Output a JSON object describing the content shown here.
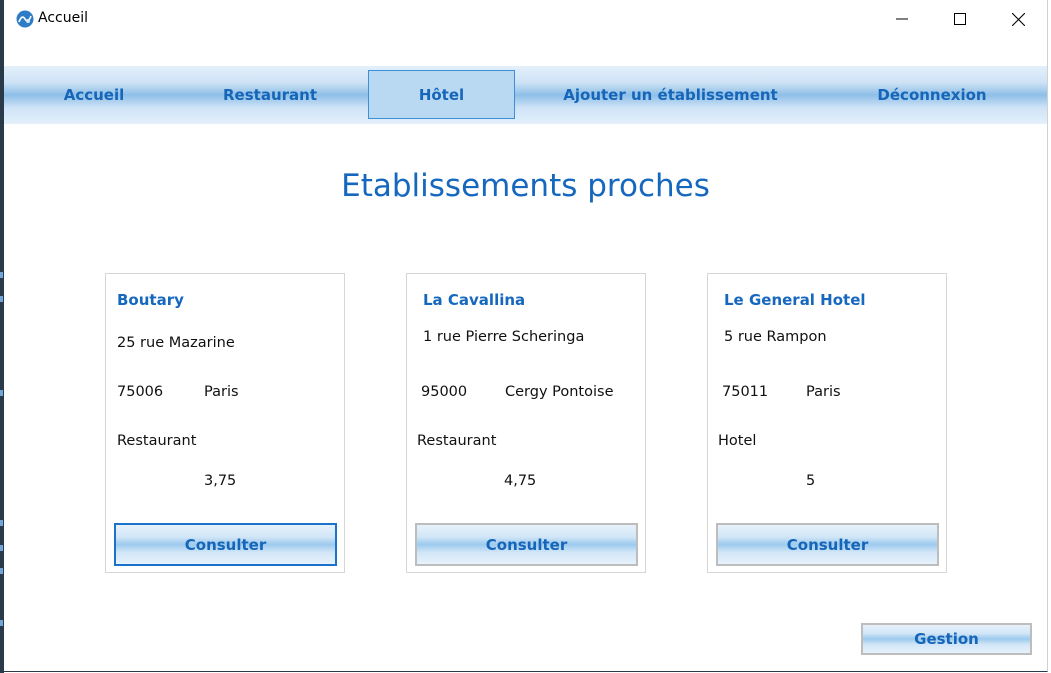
{
  "window": {
    "title": "Accueil"
  },
  "nav": {
    "items": [
      {
        "label": "Accueil"
      },
      {
        "label": "Restaurant"
      },
      {
        "label": "Hôtel"
      },
      {
        "label": "Ajouter un établissement"
      },
      {
        "label": "Déconnexion"
      }
    ],
    "active_index": 2
  },
  "page": {
    "title": "Etablissements proches"
  },
  "cards": [
    {
      "name": "Boutary",
      "address": "25 rue Mazarine",
      "postal_code": "75006",
      "city": "Paris",
      "type": "Restaurant",
      "rating": "3,75",
      "button": "Consulter"
    },
    {
      "name": "La Cavallina",
      "address": "1 rue Pierre Scheringa",
      "postal_code": "95000",
      "city": "Cergy Pontoise",
      "type": "Restaurant",
      "rating": "4,75",
      "button": "Consulter"
    },
    {
      "name": "Le General Hotel",
      "address": "5 rue Rampon",
      "postal_code": "75011",
      "city": "Paris",
      "type": "Hotel",
      "rating": "5",
      "button": "Consulter"
    }
  ],
  "footer": {
    "gestion_label": "Gestion"
  },
  "colors": {
    "accent": "#1668bf",
    "nav_active_bg": "#b9d9f3",
    "nav_active_border": "#3d8fd6"
  },
  "icons": {
    "app": "app-logo-icon",
    "minimize": "minimize-icon",
    "maximize": "maximize-icon",
    "close": "close-icon"
  }
}
